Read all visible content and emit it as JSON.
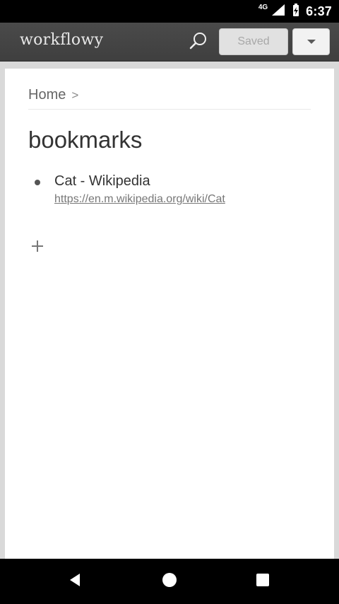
{
  "status_bar": {
    "network": "4G",
    "time": "6:37",
    "icons": [
      "signal-icon",
      "battery-charging-icon"
    ]
  },
  "app_bar": {
    "brand": "workflowy",
    "saved_label": "Saved",
    "icons": [
      "search-icon",
      "caret-down-icon"
    ]
  },
  "breadcrumb": {
    "home": "Home",
    "separator": ">"
  },
  "page": {
    "title": "bookmarks",
    "items": [
      {
        "title": "Cat - Wikipedia",
        "url": "https://en.m.wikipedia.org/wiki/Cat"
      }
    ],
    "add_icon": "plus-icon"
  },
  "nav_bar": {
    "icons": [
      "back-icon",
      "home-icon",
      "recents-icon"
    ]
  },
  "colors": {
    "status_bar": "#000000",
    "app_bar": "#444444",
    "background": "#d9d9d9",
    "card": "#ffffff",
    "text": "#333333"
  }
}
